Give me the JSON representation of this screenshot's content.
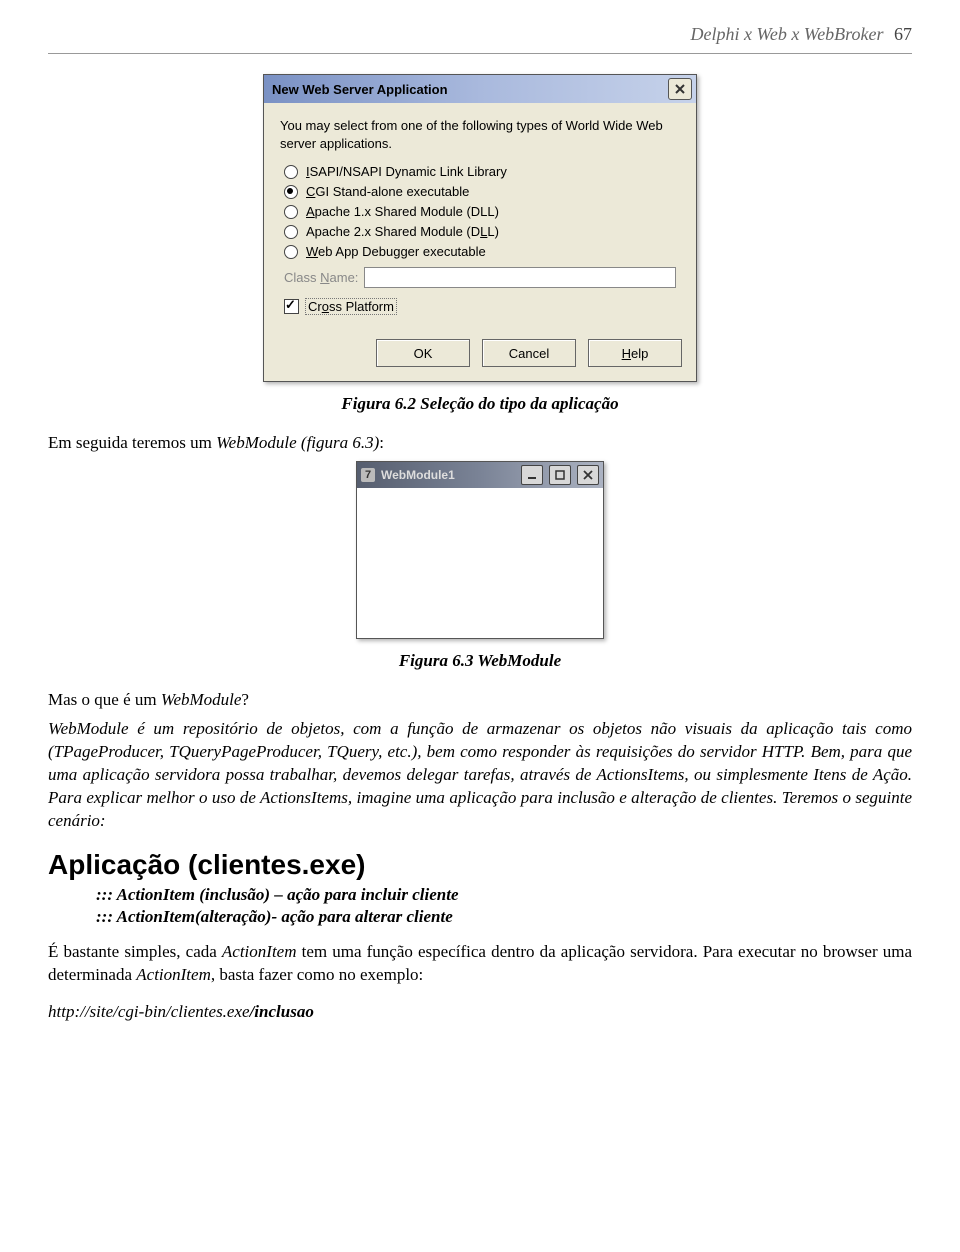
{
  "header": {
    "title": "Delphi x Web x WebBroker",
    "page_num": "67"
  },
  "dialog1": {
    "title": "New Web Server Application",
    "intro": "You may select from one of the following types of World Wide Web server applications.",
    "options": [
      {
        "pre": "",
        "u": "I",
        "post": "SAPI/NSAPI Dynamic Link Library",
        "checked": false
      },
      {
        "pre": "",
        "u": "C",
        "post": "GI Stand-alone executable",
        "checked": true
      },
      {
        "pre": "",
        "u": "A",
        "post": "pache 1.x Shared Module (DLL)",
        "checked": false
      },
      {
        "pre": "Apache 2.x Shared Module (D",
        "u": "L",
        "post": "L)",
        "checked": false
      },
      {
        "pre": "",
        "u": "W",
        "post": "eb App Debugger executable",
        "checked": false
      }
    ],
    "class_label_pre": "Class ",
    "class_label_u": "N",
    "class_label_post": "ame:",
    "cross_u": "o",
    "cross_pre": "Cr",
    "cross_post": "ss Platform",
    "buttons": {
      "ok": "OK",
      "cancel": "Cancel",
      "help_u": "H",
      "help_post": "elp"
    }
  },
  "caption1": "Figura 6.2 Seleção do tipo da aplicação",
  "para1": {
    "pre": "Em seguida teremos um ",
    "it": "WebModule (figura 6.3)",
    "post": ":"
  },
  "win2": {
    "title": "WebModule1",
    "icon": "7"
  },
  "caption2": "Figura 6.3 WebModule",
  "para2": {
    "pre": "Mas o que é um ",
    "it": "WebModule",
    "post": "?"
  },
  "para3": "WebModule é um repositório de objetos, com a função de armazenar os objetos não visuais da aplicação tais como (TPageProducer, TQueryPageProducer, TQuery, etc.), bem como responder às requisições do servidor HTTP. Bem, para que uma aplicação servidora possa trabalhar, devemos delegar tarefas, através de ActionsItems, ou simplesmente Itens de Ação. Para explicar melhor o uso de ActionsItems, imagine uma aplicação para inclusão e alteração de clientes. Teremos o seguinte cenário:",
  "h2": "Aplicação (clientes.exe)",
  "li1": "::: ActionItem (inclusão) – ação para incluir cliente",
  "li2": "::: ActionItem(alteração)- ação para alterar cliente",
  "para4": {
    "pre": "É bastante simples, cada ",
    "it1": "ActionItem",
    "mid": " tem uma função específica dentro da aplicação servidora. Para executar no browser uma determinada ",
    "it2": "ActionItem",
    "post": ", basta fazer como no exemplo:"
  },
  "url": {
    "pre": "http://site/cgi-bin/clientes.exe",
    "bold": "/inclusao"
  }
}
